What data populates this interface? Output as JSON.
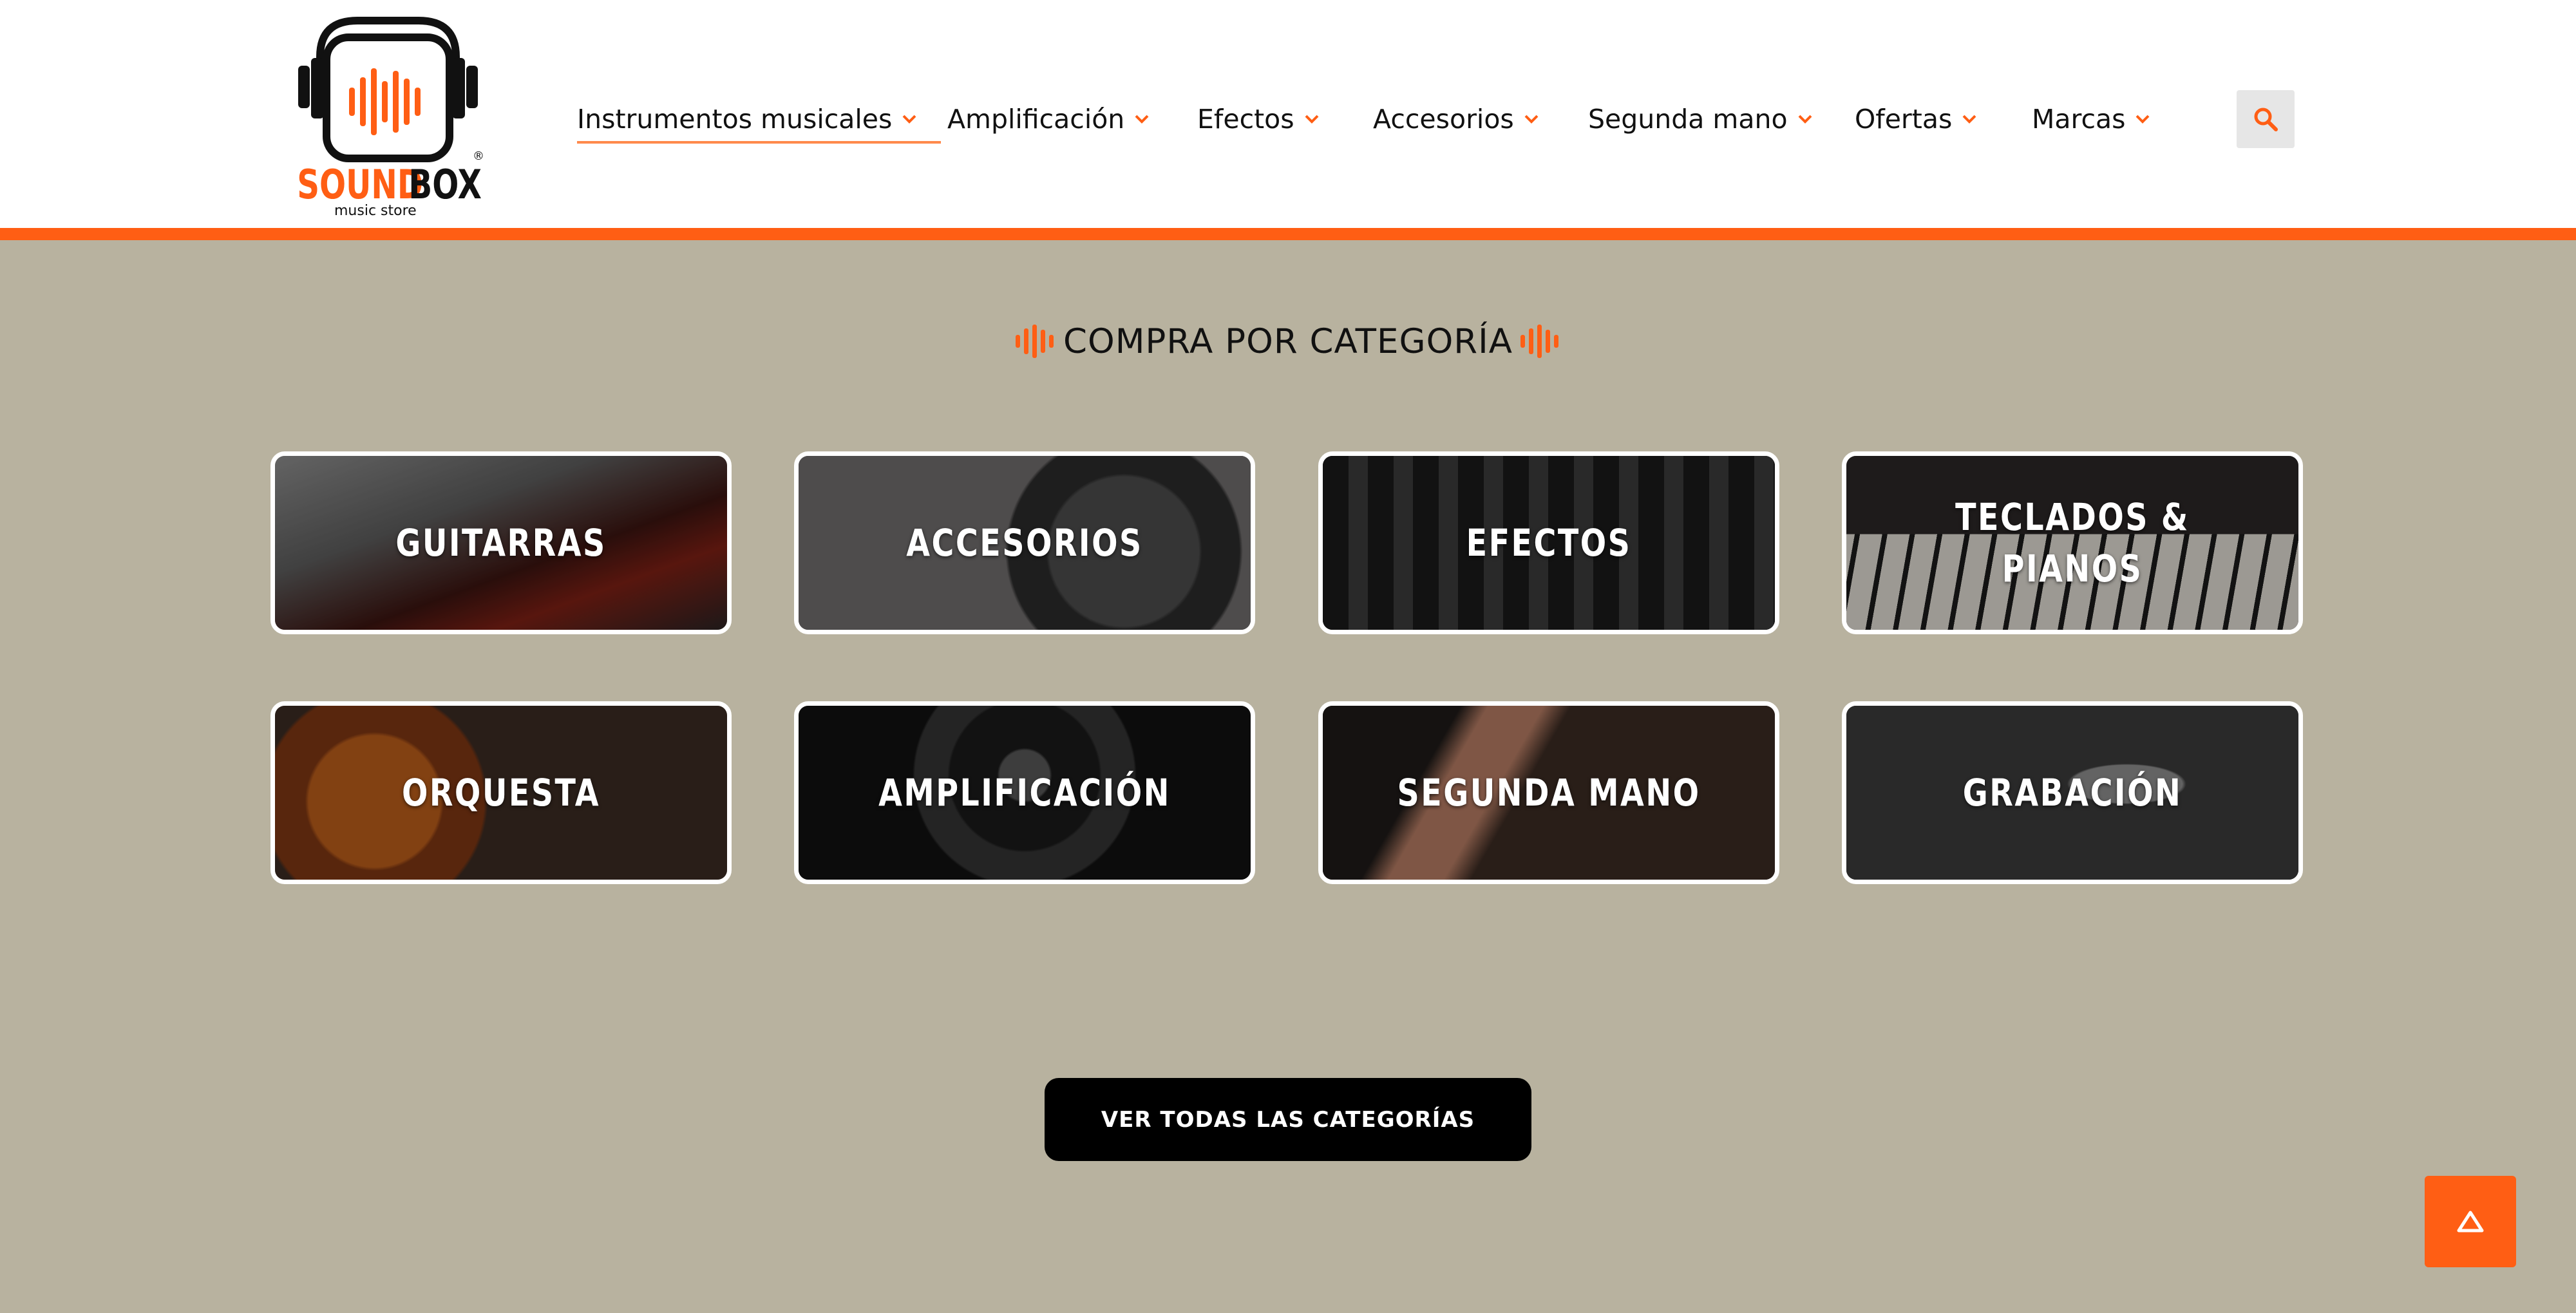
{
  "brand": {
    "name_part1": "SOUND",
    "name_part2": "BOX",
    "tagline": "music store",
    "registered": "®",
    "accent_color": "#ff5e14"
  },
  "nav": {
    "items": [
      {
        "label": "Instrumentos musicales",
        "active": true
      },
      {
        "label": "Amplificación"
      },
      {
        "label": "Efectos"
      },
      {
        "label": "Accesorios"
      },
      {
        "label": "Segunda mano"
      },
      {
        "label": "Ofertas"
      },
      {
        "label": "Marcas"
      }
    ],
    "search_icon": "search-icon"
  },
  "section": {
    "title": "COMPRA POR CATEGORÍA"
  },
  "categories": [
    {
      "label": "GUITARRAS",
      "theme": "electric guitar"
    },
    {
      "label": "ACCESORIOS",
      "theme": "headphones"
    },
    {
      "label": "EFECTOS",
      "theme": "mixer controller"
    },
    {
      "label": "TECLADOS & PIANOS",
      "theme": "keyboard"
    },
    {
      "label": "ORQUESTA",
      "theme": "violin scroll"
    },
    {
      "label": "AMPLIFICACIÓN",
      "theme": "speaker"
    },
    {
      "label": "SEGUNDA MANO",
      "theme": "guitar fretboard hand"
    },
    {
      "label": "GRABACIÓN",
      "theme": "studio microphone"
    }
  ],
  "cta": {
    "label": "VER TODAS LAS CATEGORÍAS"
  },
  "scroll_top": {
    "icon": "arrow-up-icon"
  }
}
